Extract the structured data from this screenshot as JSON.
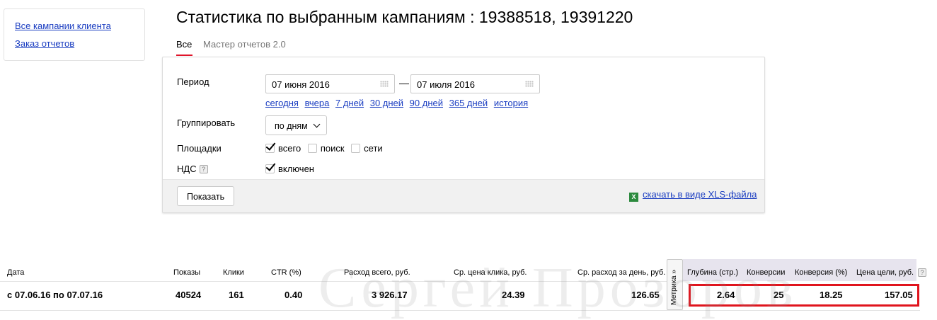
{
  "sidebar": {
    "links": [
      "Все кампании клиента",
      "Заказ отчетов"
    ]
  },
  "page_title": "Статистика по выбранным кампаниям : 19388518, 19391220",
  "tabs": [
    {
      "label": "Все",
      "active": true
    },
    {
      "label": "Мастер отчетов 2.0",
      "active": false
    }
  ],
  "filters": {
    "period_label": "Период",
    "date_from": "07 июня 2016",
    "date_to": "07 июля 2016",
    "dash": "—",
    "quick_links": [
      "сегодня",
      "вчера",
      "7 дней",
      "30 дней",
      "90 дней",
      "365 дней",
      "история"
    ],
    "group_label": "Группировать",
    "group_value": "по дням",
    "platforms_label": "Площадки",
    "platforms": [
      {
        "label": "всего",
        "checked": true
      },
      {
        "label": "поиск",
        "checked": false
      },
      {
        "label": "сети",
        "checked": false
      }
    ],
    "vat_label": "НДС",
    "vat_help": "?",
    "vat_option": {
      "label": "включен",
      "checked": true
    },
    "show_button": "Показать",
    "xls_link": "скачать в виде XLS-файла"
  },
  "stats": {
    "headers": [
      "Дата",
      "Показы",
      "Клики",
      "CTR (%)",
      "Расход всего, руб.",
      "Ср. цена клика, руб.",
      "Ср. расход за день, руб."
    ],
    "metrika_tab": "Метрика »",
    "metrika_headers": [
      "Глубина (стр.)",
      "Конверсии",
      "Конверсия (%)",
      "Цена цели, руб."
    ],
    "help": "?",
    "row": [
      "с 07.06.16 по 07.07.16",
      "40524",
      "161",
      "0.40",
      "3 926.17",
      "24.39",
      "126.65"
    ],
    "metrika_row": [
      "2.64",
      "25",
      "18.25",
      "157.05"
    ],
    "highlight_color": "#e0141d"
  },
  "watermark": "Сергей Прозоров"
}
